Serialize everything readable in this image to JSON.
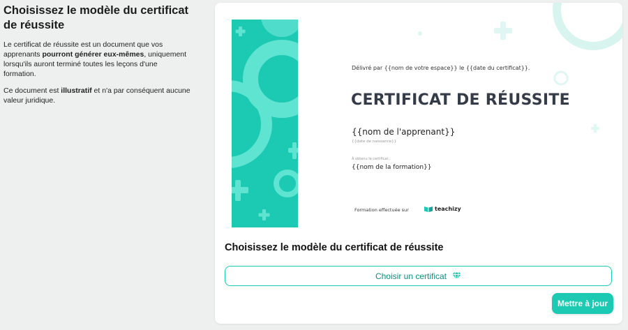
{
  "left": {
    "title": "Choisissez le modèle du certificat de réussite",
    "p1_a": "Le certificat de réussite est un document que vos apprenants ",
    "p1_b": "pourront générer eux-mêmes",
    "p1_c": ", uniquement lorsqu'ils auront terminé toutes les leçons d'une formation.",
    "p2_a": "Ce document est ",
    "p2_b": "illustratif",
    "p2_c": " et n'a par conséquent aucune valeur juridique."
  },
  "certificate": {
    "issued_line": "Délivré par {{nom de votre espace}} le {{date du certificat}}.",
    "title": "CERTIFICAT DE RÉUSSITE",
    "learner": "{{nom de l'apprenant}}",
    "birth": "{{date de naissance}}",
    "obtained": "À obtenu le certificat :",
    "course": "{{nom de la formation}}",
    "footer_note": "Formation effectuée sur",
    "brand": "teachizy"
  },
  "section": {
    "title": "Choisissez le modèle du certificat de réussite",
    "choose_label": "Choisir un certificat",
    "update_label": "Mettre à jour"
  },
  "colors": {
    "accent": "#1cc9b3",
    "accent_text": "#0f8c7d",
    "title_dark": "#353c48"
  }
}
